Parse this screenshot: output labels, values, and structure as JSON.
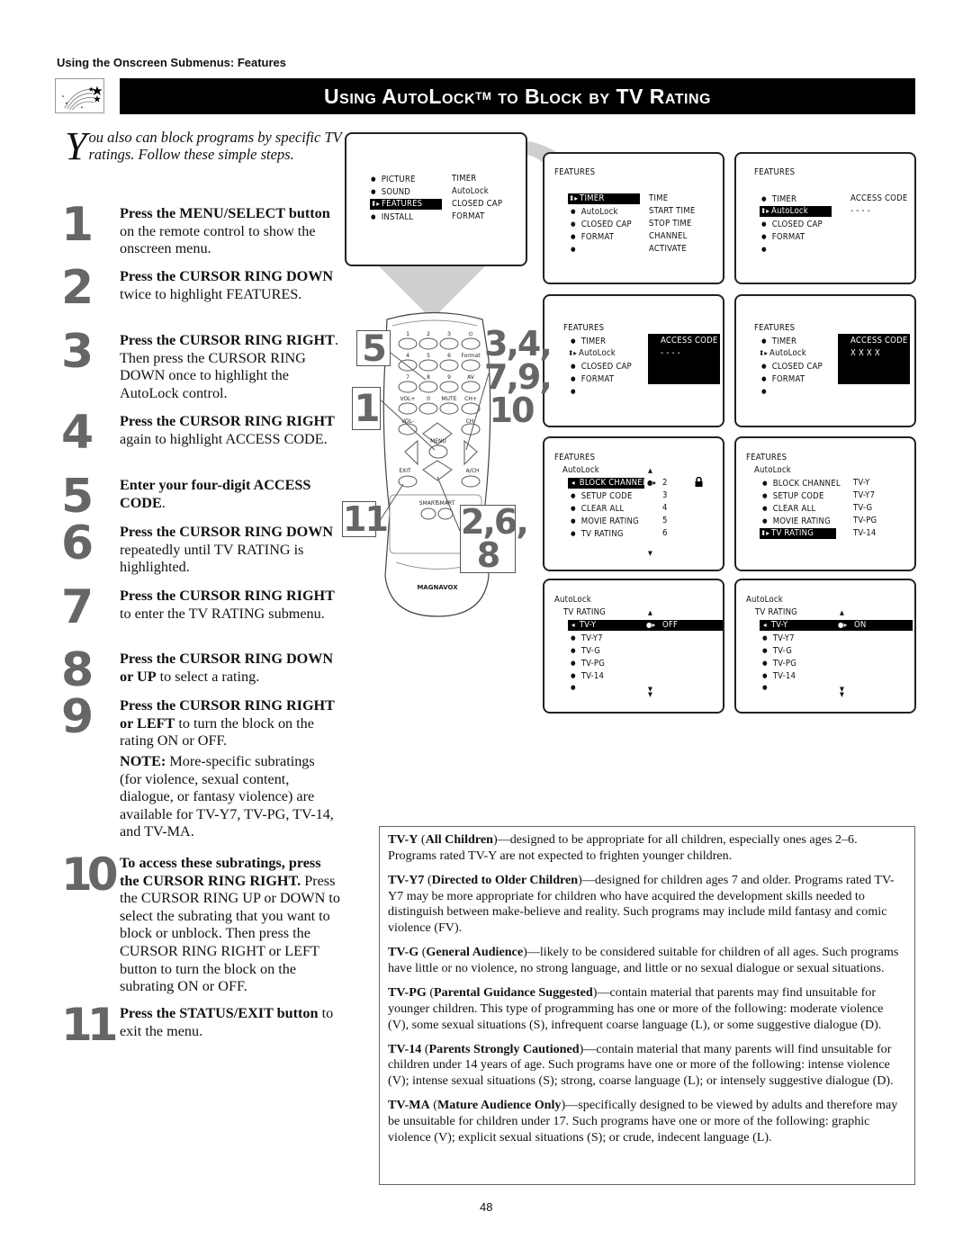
{
  "header": {
    "section_label": "Using the Onscreen Submenus: Features",
    "title_main": "Using AutoLock",
    "title_tm": "TM",
    "title_rest": " to Block by TV Rating",
    "logo_icon": "shooting-stars-icon"
  },
  "intro": {
    "dropcap": "Y",
    "text": "ou also can block programs by specific TV ratings. Follow these simple steps."
  },
  "steps": [
    {
      "num": "1",
      "bold": "Press the MENU/SELECT button",
      "rest": " on the remote control to show the onscreen menu."
    },
    {
      "num": "2",
      "bold": "Press the CURSOR RING DOWN",
      "rest": " twice to highlight FEATURES."
    },
    {
      "num": "3",
      "bold": "Press the CURSOR RING RIGHT",
      "rest": ". Then press the CURSOR RING DOWN once to highlight the AutoLock control."
    },
    {
      "num": "4",
      "bold": "Press the CURSOR RING RIGHT",
      "rest": " again to highlight ACCESS CODE."
    },
    {
      "num": "5",
      "bold": "Enter your four-digit ACCESS CODE",
      "rest": "."
    },
    {
      "num": "6",
      "bold": "Press the CURSOR RING DOWN",
      "rest": " repeatedly until TV RATING is highlighted."
    },
    {
      "num": "7",
      "bold": "Press the CURSOR RING RIGHT",
      "rest": " to enter the TV RATING submenu."
    },
    {
      "num": "8",
      "bold": "Press the CURSOR RING DOWN or UP",
      "rest": " to select a rating."
    },
    {
      "num": "9",
      "bold": "Press the CURSOR RING RIGHT or LEFT",
      "rest": " to turn the block on the rating ON or OFF."
    },
    {
      "num": "10",
      "bold": "To access these subratings, press the CURSOR RING RIGHT.",
      "rest": " Press the CURSOR RING UP or DOWN to select the subrating that you want to block or unblock. Then press the CURSOR RING RIGHT or LEFT button to turn the block on the subrating ON or OFF."
    },
    {
      "num": "11",
      "bold": "Press the STATUS/EXIT button",
      "rest": " to exit the menu."
    }
  ],
  "note": {
    "label": "NOTE:",
    "text": " More-specific subratings (for violence, sexual content, dialogue, or fantasy violence) are available for TV-Y7, TV-PG, TV-14, and TV-MA."
  },
  "screens": {
    "main_menu": {
      "left": [
        "PICTURE",
        "SOUND",
        "FEATURES",
        "INSTALL"
      ],
      "right": [
        "TIMER",
        "AutoLock",
        "CLOSED CAP",
        "FORMAT"
      ],
      "highlighted": "FEATURES"
    },
    "features_timer": {
      "title": "FEATURES",
      "left": [
        "TIMER",
        "AutoLock",
        "CLOSED CAP",
        "FORMAT",
        ""
      ],
      "right": [
        "TIME",
        "START TIME",
        "STOP TIME",
        "CHANNEL",
        "ACTIVATE"
      ],
      "highlighted": "TIMER"
    },
    "features_autolock": {
      "title": "FEATURES",
      "left": [
        "TIMER",
        "AutoLock",
        "CLOSED CAP",
        "FORMAT",
        ""
      ],
      "right_title": "ACCESS CODE",
      "right_value": "- - - -",
      "highlighted": "AutoLock"
    },
    "access_code_empty": {
      "title": "FEATURES",
      "left": [
        "TIMER",
        "AutoLock",
        "CLOSED CAP",
        "FORMAT",
        ""
      ],
      "box_title": "ACCESS CODE",
      "box_value": "- - - -"
    },
    "access_code_entered": {
      "title": "FEATURES",
      "left": [
        "TIMER",
        "AutoLock",
        "CLOSED CAP",
        "FORMAT",
        ""
      ],
      "box_title": "ACCESS CODE",
      "box_value": "X X X X"
    },
    "autolock_menu": {
      "title": "FEATURES",
      "subtitle": "AutoLock",
      "left": [
        "BLOCK CHANNEL",
        "SETUP CODE",
        "CLEAR ALL",
        "MOVIE RATING",
        "TV RATING"
      ],
      "right": [
        "2",
        "3",
        "4",
        "5",
        "6"
      ],
      "highlighted": "BLOCK CHANNEL",
      "lock_icon": "padlock-icon"
    },
    "autolock_tv_rating": {
      "title": "FEATURES",
      "subtitle": "AutoLock",
      "left": [
        "BLOCK CHANNEL",
        "SETUP CODE",
        "CLEAR ALL",
        "MOVIE RATING",
        "TV RATING"
      ],
      "right": [
        "TV-Y",
        "TV-Y7",
        "TV-G",
        "TV-PG",
        "TV-14"
      ],
      "highlighted": "TV RATING"
    },
    "tv_rating_off": {
      "title": "AutoLock",
      "subtitle": "TV RATING",
      "items": [
        "TV-Y",
        "TV-Y7",
        "TV-G",
        "TV-PG",
        "TV-14",
        ""
      ],
      "highlighted": "TV-Y",
      "value": "OFF"
    },
    "tv_rating_on": {
      "title": "AutoLock",
      "subtitle": "TV RATING",
      "items": [
        "TV-Y",
        "TV-Y7",
        "TV-G",
        "TV-PG",
        "TV-14",
        ""
      ],
      "highlighted": "TV-Y",
      "value": "ON"
    }
  },
  "remote": {
    "brand": "MAGNAVOX",
    "buttons": [
      "1",
      "2",
      "3",
      "⏻",
      "4",
      "5",
      "6",
      "Format",
      "7",
      "8",
      "9",
      "AV",
      "VOL+",
      "0",
      "MUTE",
      "CH+",
      "VOL-",
      "CH-",
      "MENU",
      "EXIT",
      "A/CH",
      "SMART",
      "SMART"
    ],
    "callouts": {
      "c5": "5",
      "c1": "1",
      "c11": "11",
      "c34": "3,4,",
      "c79": "7,9,",
      "c10": "10",
      "c26": "2,6,",
      "c8": "8"
    }
  },
  "ratings": [
    {
      "code": "TV-Y",
      "name": "All Children",
      "sep": "—",
      "desc": "designed to be appropriate for all children, especially ones ages 2–6. Programs rated TV-Y are not expected to frighten younger children."
    },
    {
      "code": "TV-Y7",
      "name": "Directed to Older Children",
      "sep": "—",
      "desc": "designed for children ages 7 and older. Programs rated TV-Y7 may be more appropriate for children who have acquired the development skills needed to distinguish between make-believe and reality. Such programs may include mild fantasy and comic violence (FV)."
    },
    {
      "code": "TV-G",
      "name": "General Audience",
      "sep": "—",
      "desc": "likely to be considered suitable for children of all ages. Such programs have little or no violence, no strong language, and little or no sexual dialogue or sexual situations."
    },
    {
      "code": "TV-PG",
      "name": "Parental Guidance Suggested",
      "sep": "—",
      "desc": "contain material that parents may find unsuitable for younger children. This type of programming has one or more of the following: moderate violence (V), some sexual situations (S), infrequent coarse language (L), or some suggestive dialogue (D)."
    },
    {
      "code": "TV-14",
      "name": "Parents Strongly Cautioned",
      "sep": "—",
      "desc": "contain material that many parents will find unsuitable for children under 14 years of age. Such programs have one or more of the following: intense violence (V); intense sexual situations (S); strong, coarse language (L); or intensely suggestive dialogue (D)."
    },
    {
      "code": "TV-MA",
      "name": "Mature Audience Only",
      "sep": "—",
      "desc": "specifically designed to be viewed by adults and therefore may be unsuitable for children under 17. Such programs have one or more of the following: graphic violence (V); explicit sexual situations (S); or crude, indecent language (L)."
    }
  ],
  "footer": {
    "page_number": "48"
  },
  "colors": {
    "title_bar_bg": "#000000",
    "step_number": "#666666",
    "beam": "#cfcfcf"
  }
}
